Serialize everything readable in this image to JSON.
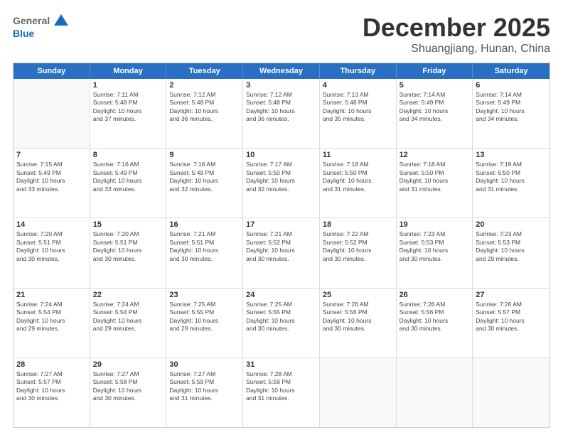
{
  "header": {
    "logo_general": "General",
    "logo_blue": "Blue",
    "month": "December 2025",
    "location": "Shuangjiang, Hunan, China"
  },
  "weekdays": [
    "Sunday",
    "Monday",
    "Tuesday",
    "Wednesday",
    "Thursday",
    "Friday",
    "Saturday"
  ],
  "rows": [
    [
      {
        "day": "",
        "info": ""
      },
      {
        "day": "1",
        "info": "Sunrise: 7:11 AM\nSunset: 5:48 PM\nDaylight: 10 hours\nand 37 minutes."
      },
      {
        "day": "2",
        "info": "Sunrise: 7:12 AM\nSunset: 5:48 PM\nDaylight: 10 hours\nand 36 minutes."
      },
      {
        "day": "3",
        "info": "Sunrise: 7:12 AM\nSunset: 5:48 PM\nDaylight: 10 hours\nand 36 minutes."
      },
      {
        "day": "4",
        "info": "Sunrise: 7:13 AM\nSunset: 5:48 PM\nDaylight: 10 hours\nand 35 minutes."
      },
      {
        "day": "5",
        "info": "Sunrise: 7:14 AM\nSunset: 5:49 PM\nDaylight: 10 hours\nand 34 minutes."
      },
      {
        "day": "6",
        "info": "Sunrise: 7:14 AM\nSunset: 5:49 PM\nDaylight: 10 hours\nand 34 minutes."
      }
    ],
    [
      {
        "day": "7",
        "info": "Sunrise: 7:15 AM\nSunset: 5:49 PM\nDaylight: 10 hours\nand 33 minutes."
      },
      {
        "day": "8",
        "info": "Sunrise: 7:16 AM\nSunset: 5:49 PM\nDaylight: 10 hours\nand 33 minutes."
      },
      {
        "day": "9",
        "info": "Sunrise: 7:16 AM\nSunset: 5:49 PM\nDaylight: 10 hours\nand 32 minutes."
      },
      {
        "day": "10",
        "info": "Sunrise: 7:17 AM\nSunset: 5:50 PM\nDaylight: 10 hours\nand 32 minutes."
      },
      {
        "day": "11",
        "info": "Sunrise: 7:18 AM\nSunset: 5:50 PM\nDaylight: 10 hours\nand 31 minutes."
      },
      {
        "day": "12",
        "info": "Sunrise: 7:18 AM\nSunset: 5:50 PM\nDaylight: 10 hours\nand 31 minutes."
      },
      {
        "day": "13",
        "info": "Sunrise: 7:19 AM\nSunset: 5:50 PM\nDaylight: 10 hours\nand 31 minutes."
      }
    ],
    [
      {
        "day": "14",
        "info": "Sunrise: 7:20 AM\nSunset: 5:51 PM\nDaylight: 10 hours\nand 30 minutes."
      },
      {
        "day": "15",
        "info": "Sunrise: 7:20 AM\nSunset: 5:51 PM\nDaylight: 10 hours\nand 30 minutes."
      },
      {
        "day": "16",
        "info": "Sunrise: 7:21 AM\nSunset: 5:51 PM\nDaylight: 10 hours\nand 30 minutes."
      },
      {
        "day": "17",
        "info": "Sunrise: 7:21 AM\nSunset: 5:52 PM\nDaylight: 10 hours\nand 30 minutes."
      },
      {
        "day": "18",
        "info": "Sunrise: 7:22 AM\nSunset: 5:52 PM\nDaylight: 10 hours\nand 30 minutes."
      },
      {
        "day": "19",
        "info": "Sunrise: 7:23 AM\nSunset: 5:53 PM\nDaylight: 10 hours\nand 30 minutes."
      },
      {
        "day": "20",
        "info": "Sunrise: 7:23 AM\nSunset: 5:53 PM\nDaylight: 10 hours\nand 29 minutes."
      }
    ],
    [
      {
        "day": "21",
        "info": "Sunrise: 7:24 AM\nSunset: 5:54 PM\nDaylight: 10 hours\nand 29 minutes."
      },
      {
        "day": "22",
        "info": "Sunrise: 7:24 AM\nSunset: 5:54 PM\nDaylight: 10 hours\nand 29 minutes."
      },
      {
        "day": "23",
        "info": "Sunrise: 7:25 AM\nSunset: 5:55 PM\nDaylight: 10 hours\nand 29 minutes."
      },
      {
        "day": "24",
        "info": "Sunrise: 7:25 AM\nSunset: 5:55 PM\nDaylight: 10 hours\nand 30 minutes."
      },
      {
        "day": "25",
        "info": "Sunrise: 7:26 AM\nSunset: 5:56 PM\nDaylight: 10 hours\nand 30 minutes."
      },
      {
        "day": "26",
        "info": "Sunrise: 7:26 AM\nSunset: 5:56 PM\nDaylight: 10 hours\nand 30 minutes."
      },
      {
        "day": "27",
        "info": "Sunrise: 7:26 AM\nSunset: 5:57 PM\nDaylight: 10 hours\nand 30 minutes."
      }
    ],
    [
      {
        "day": "28",
        "info": "Sunrise: 7:27 AM\nSunset: 5:57 PM\nDaylight: 10 hours\nand 30 minutes."
      },
      {
        "day": "29",
        "info": "Sunrise: 7:27 AM\nSunset: 5:58 PM\nDaylight: 10 hours\nand 30 minutes."
      },
      {
        "day": "30",
        "info": "Sunrise: 7:27 AM\nSunset: 5:59 PM\nDaylight: 10 hours\nand 31 minutes."
      },
      {
        "day": "31",
        "info": "Sunrise: 7:28 AM\nSunset: 5:59 PM\nDaylight: 10 hours\nand 31 minutes."
      },
      {
        "day": "",
        "info": ""
      },
      {
        "day": "",
        "info": ""
      },
      {
        "day": "",
        "info": ""
      }
    ]
  ]
}
